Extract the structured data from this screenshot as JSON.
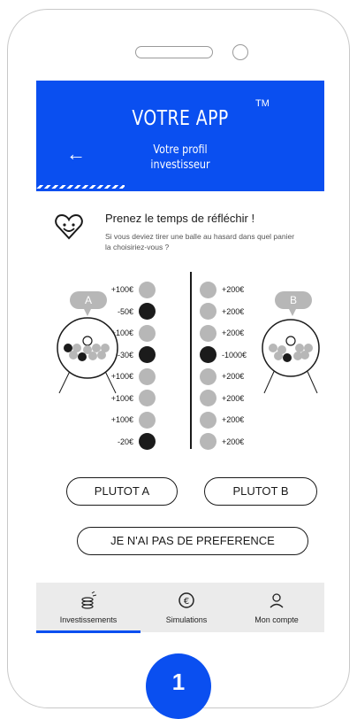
{
  "header": {
    "title": "VOTRE APP",
    "trademark": "TM",
    "subtitle_line1": "Votre profil",
    "subtitle_line2": "investisseur",
    "back_icon": "arrow-left-icon"
  },
  "intro": {
    "title": "Prenez le temps de réfléchir !",
    "text": "Si vous deviez tirer une balle au hasard dans quel panier la choisiriez-vous ?",
    "icon": "heart-smile-icon"
  },
  "urns": {
    "a_label": "A",
    "b_label": "B"
  },
  "basket_a": [
    {
      "amount": "+100€",
      "color": "grey"
    },
    {
      "amount": "-50€",
      "color": "black"
    },
    {
      "amount": "+100€",
      "color": "grey"
    },
    {
      "amount": "-30€",
      "color": "black"
    },
    {
      "amount": "+100€",
      "color": "grey"
    },
    {
      "amount": "+100€",
      "color": "grey"
    },
    {
      "amount": "+100€",
      "color": "grey"
    },
    {
      "amount": "-20€",
      "color": "black"
    }
  ],
  "basket_b": [
    {
      "amount": "+200€",
      "color": "grey"
    },
    {
      "amount": "+200€",
      "color": "grey"
    },
    {
      "amount": "+200€",
      "color": "grey"
    },
    {
      "amount": "-1000€",
      "color": "black"
    },
    {
      "amount": "+200€",
      "color": "grey"
    },
    {
      "amount": "+200€",
      "color": "grey"
    },
    {
      "amount": "+200€",
      "color": "grey"
    },
    {
      "amount": "+200€",
      "color": "grey"
    }
  ],
  "buttons": {
    "a": "PLUTOT A",
    "b": "PLUTOT B",
    "none": "JE N'AI PAS DE PREFERENCE"
  },
  "tabs": [
    {
      "label": "Investissements",
      "icon": "coins-icon",
      "active": true
    },
    {
      "label": "Simulations",
      "icon": "euro-coin-icon",
      "active": false
    },
    {
      "label": "Mon compte",
      "icon": "user-icon",
      "active": false
    }
  ],
  "page_number": "1",
  "colors": {
    "accent": "#0a4ff0",
    "grey_ball": "#b7b7b7",
    "black_ball": "#1b1b1b"
  }
}
